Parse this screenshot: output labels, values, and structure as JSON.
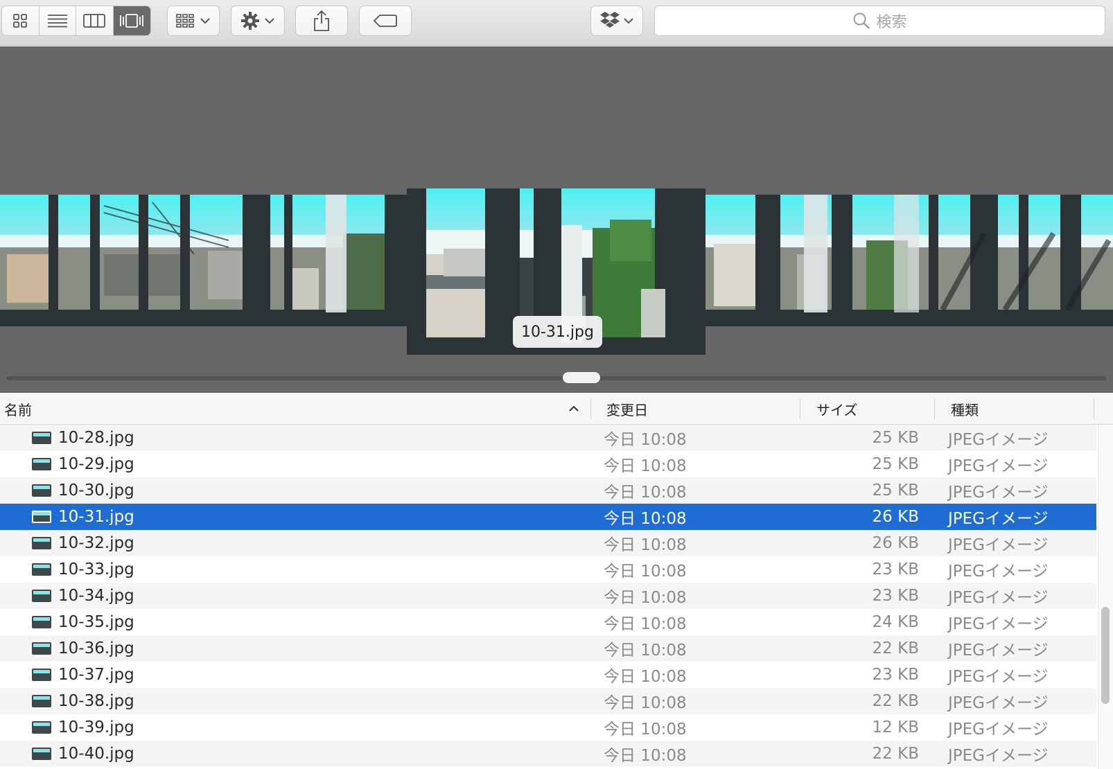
{
  "toolbar": {
    "view_buttons": [
      {
        "icon": "icon-view-icon",
        "active": false
      },
      {
        "icon": "list-view-icon",
        "active": false
      },
      {
        "icon": "column-view-icon",
        "active": false
      },
      {
        "icon": "cover-flow-view-icon",
        "active": true
      }
    ],
    "arrange_icon": "group-arrange-icon",
    "action_icon": "gear-icon",
    "share_icon": "share-icon",
    "tag_icon": "tag-icon",
    "dropbox_icon": "dropbox-icon",
    "search": {
      "placeholder": "検索",
      "icon": "search-icon"
    }
  },
  "coverflow": {
    "selected_caption": "10-31.jpg",
    "sky_color": "#5ee8f0"
  },
  "list": {
    "columns": {
      "name": "名前",
      "date": "変更日",
      "size": "サイズ",
      "kind": "種類"
    },
    "sort": {
      "column": "name",
      "direction": "ascending"
    },
    "selection_color": "#1f6cd3",
    "rows": [
      {
        "name": "10-28.jpg",
        "date": "今日 10:08",
        "size": "25 KB",
        "kind": "JPEGイメージ",
        "selected": false
      },
      {
        "name": "10-29.jpg",
        "date": "今日 10:08",
        "size": "25 KB",
        "kind": "JPEGイメージ",
        "selected": false
      },
      {
        "name": "10-30.jpg",
        "date": "今日 10:08",
        "size": "25 KB",
        "kind": "JPEGイメージ",
        "selected": false
      },
      {
        "name": "10-31.jpg",
        "date": "今日 10:08",
        "size": "26 KB",
        "kind": "JPEGイメージ",
        "selected": true
      },
      {
        "name": "10-32.jpg",
        "date": "今日 10:08",
        "size": "26 KB",
        "kind": "JPEGイメージ",
        "selected": false
      },
      {
        "name": "10-33.jpg",
        "date": "今日 10:08",
        "size": "23 KB",
        "kind": "JPEGイメージ",
        "selected": false
      },
      {
        "name": "10-34.jpg",
        "date": "今日 10:08",
        "size": "23 KB",
        "kind": "JPEGイメージ",
        "selected": false
      },
      {
        "name": "10-35.jpg",
        "date": "今日 10:08",
        "size": "24 KB",
        "kind": "JPEGイメージ",
        "selected": false
      },
      {
        "name": "10-36.jpg",
        "date": "今日 10:08",
        "size": "22 KB",
        "kind": "JPEGイメージ",
        "selected": false
      },
      {
        "name": "10-37.jpg",
        "date": "今日 10:08",
        "size": "23 KB",
        "kind": "JPEGイメージ",
        "selected": false
      },
      {
        "name": "10-38.jpg",
        "date": "今日 10:08",
        "size": "22 KB",
        "kind": "JPEGイメージ",
        "selected": false
      },
      {
        "name": "10-39.jpg",
        "date": "今日 10:08",
        "size": "12 KB",
        "kind": "JPEGイメージ",
        "selected": false
      },
      {
        "name": "10-40.jpg",
        "date": "今日 10:08",
        "size": "22 KB",
        "kind": "JPEGイメージ",
        "selected": false
      }
    ]
  }
}
